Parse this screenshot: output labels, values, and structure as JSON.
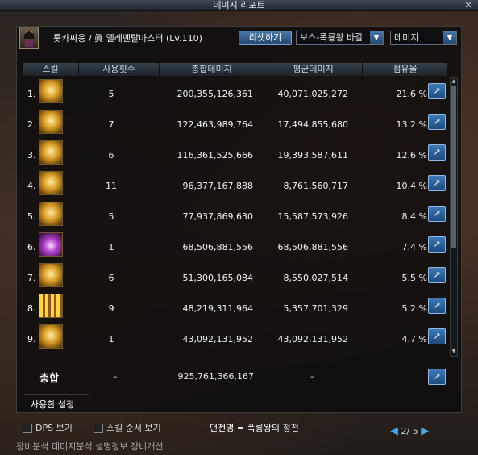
{
  "window": {
    "title": "데미지 리포트",
    "close_icon": "close-icon"
  },
  "character": {
    "name_line": "룻카짜응 / 眞 엘레멘탈마스터 (Lv.110)"
  },
  "controls": {
    "reset_label": "리셋하기",
    "dungeon_select": "보스-폭룡왕 바칼",
    "metric_select": "데미지"
  },
  "columns": [
    "스킬",
    "사용횟수",
    "총합데미지",
    "평균데미지",
    "점유율"
  ],
  "rows": [
    {
      "rank": "1.",
      "uses": "5",
      "total": "200,355,126,361",
      "avg": "40,071,025,272",
      "share": "21.6 %"
    },
    {
      "rank": "2.",
      "uses": "7",
      "total": "122,463,989,764",
      "avg": "17,494,855,680",
      "share": "13.2 %"
    },
    {
      "rank": "3.",
      "uses": "6",
      "total": "116,361,525,666",
      "avg": "19,393,587,611",
      "share": "12.6 %"
    },
    {
      "rank": "4.",
      "uses": "11",
      "total": "96,377,167,888",
      "avg": "8,761,560,717",
      "share": "10.4 %"
    },
    {
      "rank": "5.",
      "uses": "5",
      "total": "77,937,869,630",
      "avg": "15,587,573,926",
      "share": "8.4 %"
    },
    {
      "rank": "6.",
      "uses": "1",
      "total": "68,506,881,556",
      "avg": "68,506,881,556",
      "share": "7.4 %"
    },
    {
      "rank": "7.",
      "uses": "6",
      "total": "51,300,165,084",
      "avg": "8,550,027,514",
      "share": "5.5 %"
    },
    {
      "rank": "8.",
      "uses": "9",
      "total": "48,219,311,964",
      "avg": "5,357,701,329",
      "share": "5.2 %"
    },
    {
      "rank": "9.",
      "uses": "1",
      "total": "43,092,131,952",
      "avg": "43,092,131,952",
      "share": "4.7 %"
    }
  ],
  "total": {
    "label": "총합",
    "uses": "–",
    "value": "925,761,366,167",
    "avg": "–"
  },
  "settings": {
    "used_settings_label": "사용한 설정",
    "dps_view": "DPS 보기",
    "skill_order_view": "스킬 순서 보기",
    "dungeon_name": "던전명 = 폭룡왕의 정전",
    "page": "2/ 5"
  },
  "bottom_menu": "장비분석   데미지분석   설명정보   장비개선"
}
